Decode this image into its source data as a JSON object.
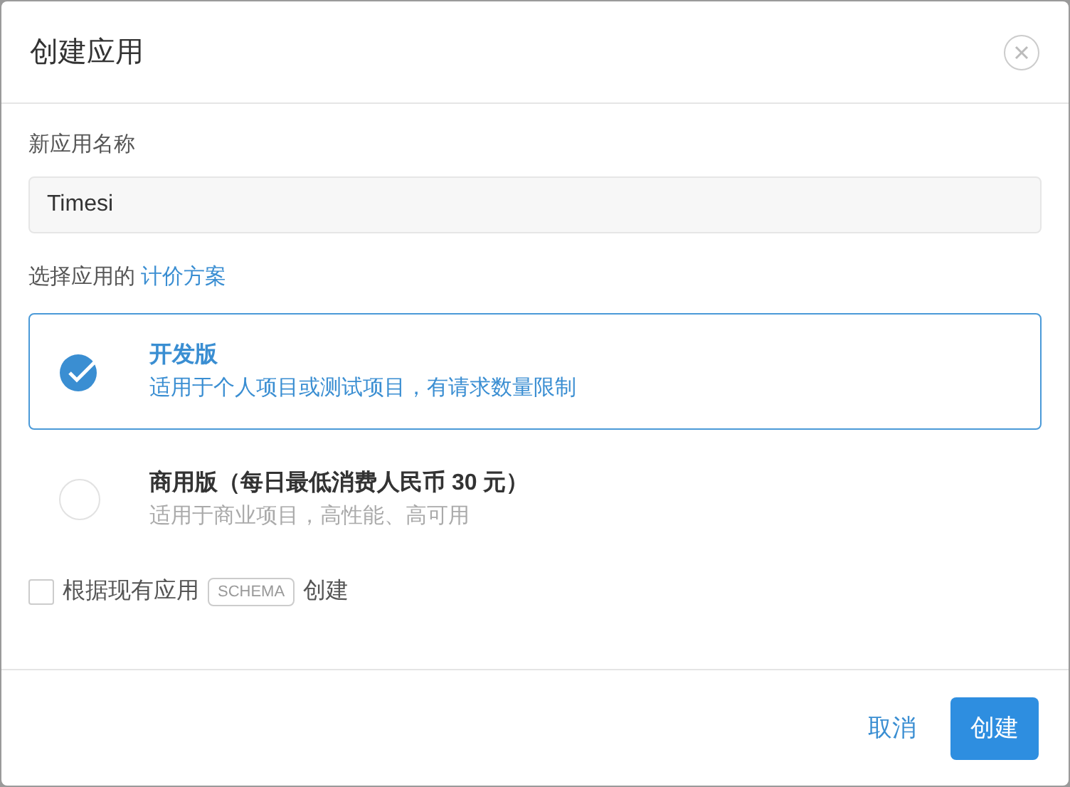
{
  "dialog": {
    "title": "创建应用"
  },
  "name_field": {
    "label": "新应用名称",
    "value": "Timesi"
  },
  "plan_prompt": {
    "text": "选择应用的",
    "link": "计价方案"
  },
  "plans": [
    {
      "title": "开发版",
      "description": "适用于个人项目或测试项目，有请求数量限制",
      "selected": true
    },
    {
      "title": "商用版（每日最低消费人民币 30 元）",
      "description": "适用于商业项目，高性能、高可用",
      "selected": false
    }
  ],
  "schema_option": {
    "checked": false,
    "text_before": "根据现有应用",
    "tag": "SCHEMA",
    "text_after": "创建"
  },
  "buttons": [
    {
      "label": "取消",
      "kind": "link"
    },
    {
      "label": "创建",
      "kind": "primary"
    }
  ]
}
